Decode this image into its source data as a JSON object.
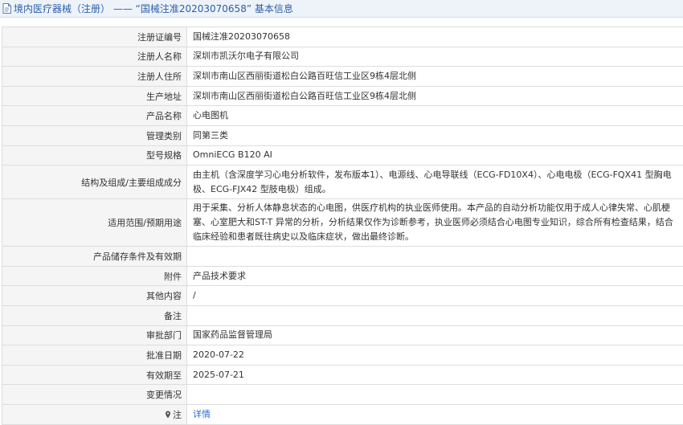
{
  "header": {
    "title": "境内医疗器械（注册） —— “国械注准20203070658” 基本信息"
  },
  "rows": [
    {
      "label": "注册证编号",
      "value": "国械注准20203070658"
    },
    {
      "label": "注册人名称",
      "value": "深圳市凯沃尔电子有限公司"
    },
    {
      "label": "注册人住所",
      "value": "深圳市南山区西丽街道松白公路百旺信工业区9栋4层北侧"
    },
    {
      "label": "生产地址",
      "value": "深圳市南山区西丽街道松白公路百旺信工业区9栋4层北侧"
    },
    {
      "label": "产品名称",
      "value": "心电图机"
    },
    {
      "label": "管理类别",
      "value": "同第三类"
    },
    {
      "label": "型号规格",
      "value": "OmniECG B120 AI"
    },
    {
      "label": "结构及组成/主要组成成分",
      "value": "由主机（含深度学习心电分析软件，发布版本1）、电源线、心电导联线（ECG-FD10X4）、心电电极（ECG-FQX41 型胸电极、ECG-FJX42 型肢电极）组成。"
    },
    {
      "label": "适用范围/预期用途",
      "value": "用于采集、分析人体静息状态的心电图，供医疗机构的执业医师使用。本产品的自动分析功能仅用于成人心律失常、心肌梗塞、心室肥大和ST-T 异常的分析，分析结果仅作为诊断参考，执业医师必须结合心电图专业知识，综合所有检查结果，结合临床经验和患者既往病史以及临床症状，做出最终诊断。"
    },
    {
      "label": "产品储存条件及有效期",
      "value": ""
    },
    {
      "label": "附件",
      "value": "产品技术要求"
    },
    {
      "label": "其他内容",
      "value": "/"
    },
    {
      "label": "备注",
      "value": ""
    },
    {
      "label": "审批部门",
      "value": "国家药品监督管理局"
    },
    {
      "label": "批准日期",
      "value": "2020-07-22"
    },
    {
      "label": "有效期至",
      "value": "2025-07-21"
    },
    {
      "label": "变更情况",
      "value": ""
    }
  ],
  "note_row": {
    "label": "注",
    "link": "详情"
  },
  "icons": {
    "header": "document-icon",
    "note": "map-pin-icon"
  },
  "colors": {
    "accent": "#2b5ea8",
    "link": "#2b6fc9",
    "label_bg": "#f5f5f5",
    "header_bg": "#eef3f9"
  }
}
